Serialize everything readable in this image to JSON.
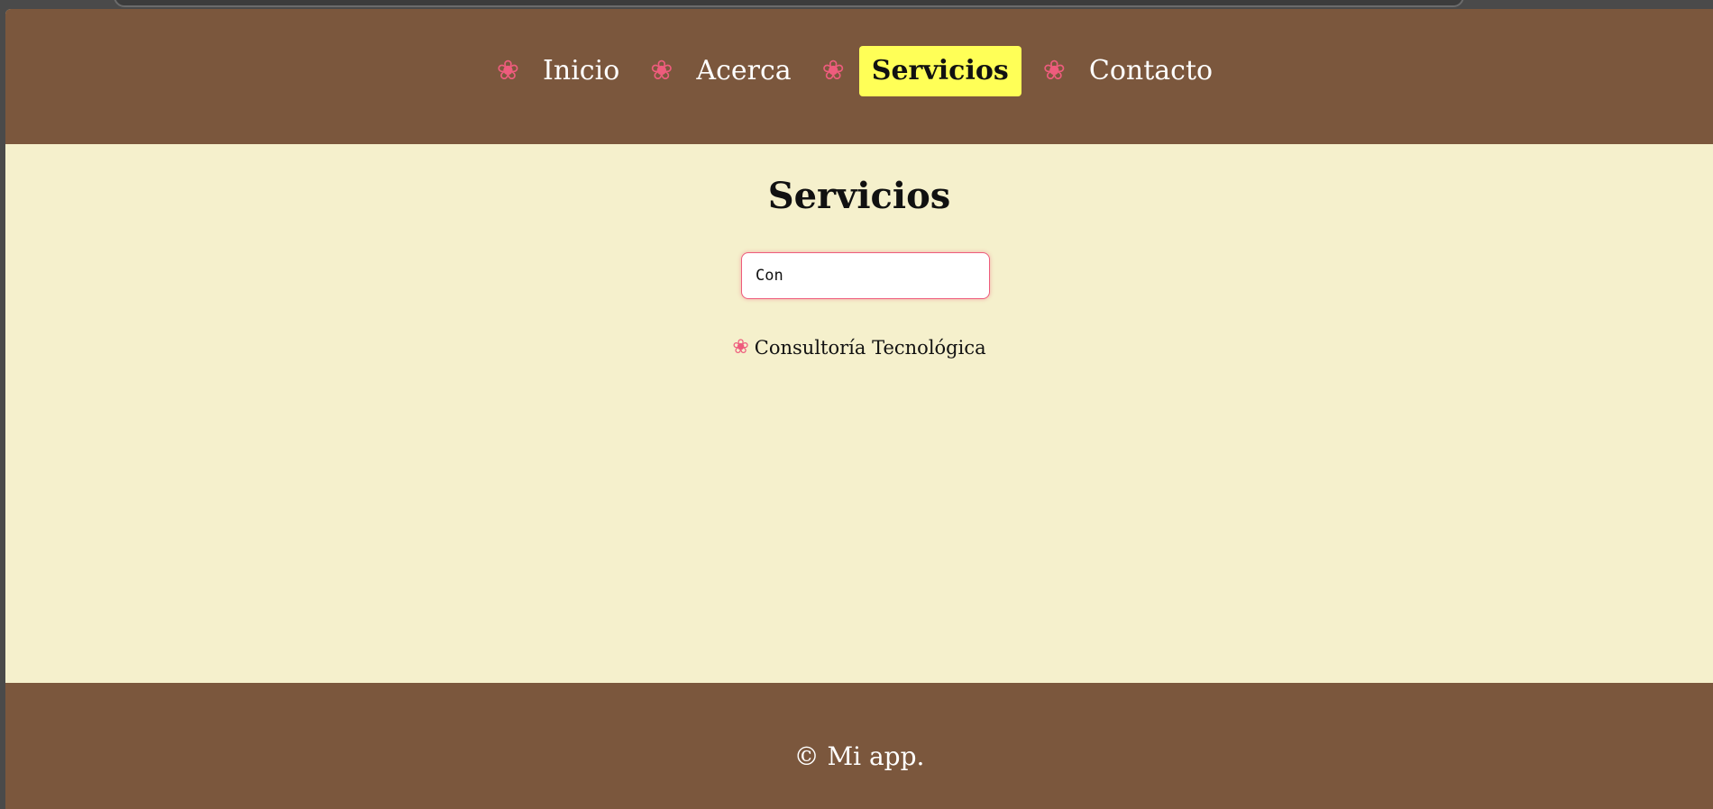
{
  "nav": {
    "items": [
      {
        "label": "Inicio",
        "active": false,
        "icon": "flower-icon"
      },
      {
        "label": "Acerca",
        "active": false,
        "icon": "flower-icon"
      },
      {
        "label": "Servicios",
        "active": true,
        "icon": "flower-icon"
      },
      {
        "label": "Contacto",
        "active": false,
        "icon": "flower-icon"
      }
    ]
  },
  "main": {
    "title": "Servicios",
    "search": {
      "value": "Con",
      "placeholder": ""
    },
    "results": [
      {
        "label": "Consultoría Tecnológica",
        "icon": "flower-icon"
      }
    ]
  },
  "footer": {
    "text": "© Mi app."
  },
  "colors": {
    "header_bg": "#7b573d",
    "page_bg": "#f5f0cc",
    "accent_pink": "#ee5c7d",
    "active_highlight": "#ffff57"
  },
  "icons": {
    "flower_glyph": "❀"
  }
}
